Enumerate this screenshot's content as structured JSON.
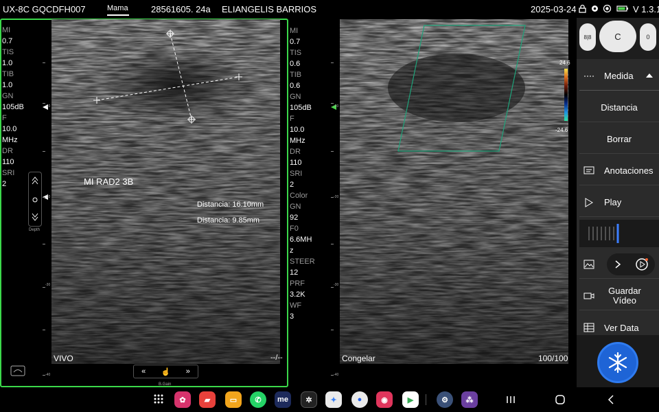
{
  "topbar": {
    "probe": "UX-8C GQCDFH007",
    "preset": "Mama",
    "patient_id": "28561605. 24a",
    "patient_name": "ELIANGELIS BARRIOS",
    "date": "2025-03-24",
    "version": "V 1.3.1"
  },
  "params_left": [
    {
      "label": "MI",
      "value": "0.7"
    },
    {
      "label": "TIS",
      "value": "1.0"
    },
    {
      "label": "TIB",
      "value": "1.0"
    },
    {
      "label": "GN",
      "value": "105dB"
    },
    {
      "label": "F",
      "value": "10.0"
    },
    {
      "label": "",
      "value": "MHz"
    },
    {
      "label": "DR",
      "value": "110"
    },
    {
      "label": "SRI",
      "value": "2"
    }
  ],
  "params_mid": [
    {
      "label": "MI",
      "value": "0.7"
    },
    {
      "label": "TIS",
      "value": "0.6"
    },
    {
      "label": "TIB",
      "value": "0.6"
    },
    {
      "label": "GN",
      "value": "105dB"
    },
    {
      "label": "F",
      "value": "10.0"
    },
    {
      "label": "",
      "value": "MHz"
    },
    {
      "label": "DR",
      "value": "110"
    },
    {
      "label": "SRI",
      "value": "2"
    },
    {
      "label": "Color",
      "value": ""
    },
    {
      "label": "GN",
      "value": "92"
    },
    {
      "label": "F0",
      "value": "6.6MH"
    },
    {
      "label": "",
      "value": "z"
    },
    {
      "label": "STEER",
      "value": "12"
    },
    {
      "label": "PRF",
      "value": "3.2K"
    },
    {
      "label": "WF",
      "value": "3"
    }
  ],
  "left_image": {
    "annotation": "MI RAD2 3B",
    "measure1": "Distancia: 16.10mm",
    "measure2": "Distancia: 9.85mm",
    "mode_label": "VIVO",
    "frame_label": "--/--",
    "depth_label": "Depth",
    "bgain_label": "B.Gain"
  },
  "right_image": {
    "mode_label": "Congelar",
    "frame_label": "100/100",
    "scale_top": "24.6",
    "scale_bottom": "-24.6"
  },
  "side_panel": {
    "top_pill_left": "8|8",
    "top_pill_center": "C",
    "top_pill_right": "0",
    "menu_header": "Medida",
    "items": {
      "distancia": "Distancia",
      "borrar": "Borrar",
      "anotaciones": "Anotaciones",
      "play": "Play",
      "guardar_video": "Guardar Vídeo",
      "ver_data": "Ver Data"
    }
  },
  "depth_marks": [
    "-10",
    "-20",
    "-30",
    "-40"
  ],
  "colors": {
    "live_border": "#3bd84a",
    "freeze_button": "#1e64d6",
    "color_box": "#1fa37a"
  }
}
